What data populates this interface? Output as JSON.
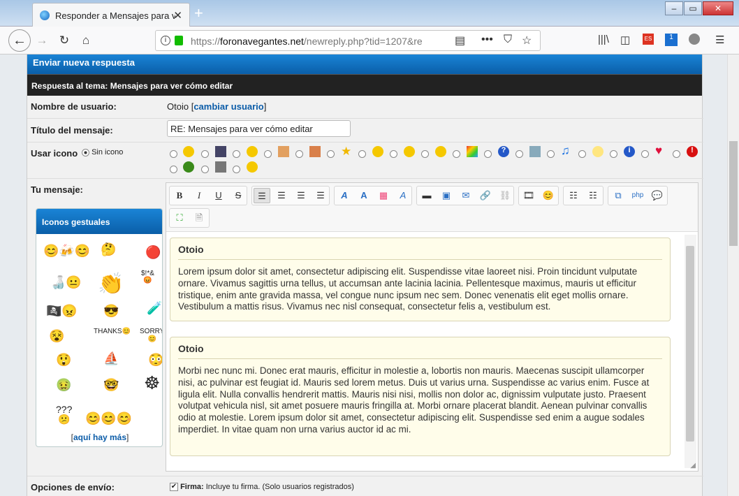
{
  "browser": {
    "tab_title": "Responder a Mensajes para ver cómo editar",
    "url_domain": "foronavegantes.net",
    "url_prefix": "https://",
    "url_path": "/newreply.php?tid=1207&re",
    "window_buttons": [
      "–",
      "▭",
      "✕"
    ],
    "badge_count": "1"
  },
  "form": {
    "header": "Enviar nueva respuesta",
    "subheader": "Respuesta al tema: Mensajes para ver cómo editar",
    "username_label": "Nombre de usuario:",
    "username": "Otoio",
    "change_user_link": "cambiar usuario",
    "title_label": "Título del mensaje:",
    "title_value": "RE: Mensajes para ver cómo editar",
    "icon_label": "Usar icono",
    "no_icon_label": "Sin icono",
    "message_label": "Tu mensaje:",
    "options_label": "Opciones de envío:",
    "signature_label": "Firma:",
    "signature_desc": "Incluye tu firma. (Solo usuarios registrados)"
  },
  "smilies_panel": {
    "title": "Iconos gestuales",
    "more_link": "aquí hay más"
  },
  "editor": {
    "quotes": [
      {
        "author": "Otoio",
        "text": "Lorem ipsum dolor sit amet, consectetur adipiscing elit. Suspendisse vitae laoreet nisi. Proin tincidunt vulputate ornare. Vivamus sagittis urna tellus, ut accumsan ante lacinia lacinia. Pellentesque maximus, mauris ut efficitur tristique, enim ante gravida massa, vel congue nunc ipsum nec sem. Donec venenatis elit eget mollis ornare. Vestibulum a mattis risus. Vivamus nec nisl consequat, consectetur felis a, vestibulum est."
      },
      {
        "author": "Otoio",
        "text": "Morbi nec nunc mi. Donec erat mauris, efficitur in molestie a, lobortis non mauris. Maecenas suscipit ullamcorper nisi, ac pulvinar est feugiat id. Mauris sed lorem metus. Duis ut varius urna. Suspendisse ac varius enim. Fusce at ligula elit. Nulla convallis hendrerit mattis. Mauris nisi nisi, mollis non dolor ac, dignissim vulputate justo. Praesent volutpat vehicula nisl, sit amet posuere mauris fringilla at. Morbi ornare placerat blandit. Aenean pulvinar convallis odio at molestie. Lorem ipsum dolor sit amet, consectetur adipiscing elit. Suspendisse sed enim a augue sodales imperdiet. In vitae quam non urna varius auctor id ac mi."
      }
    ]
  }
}
